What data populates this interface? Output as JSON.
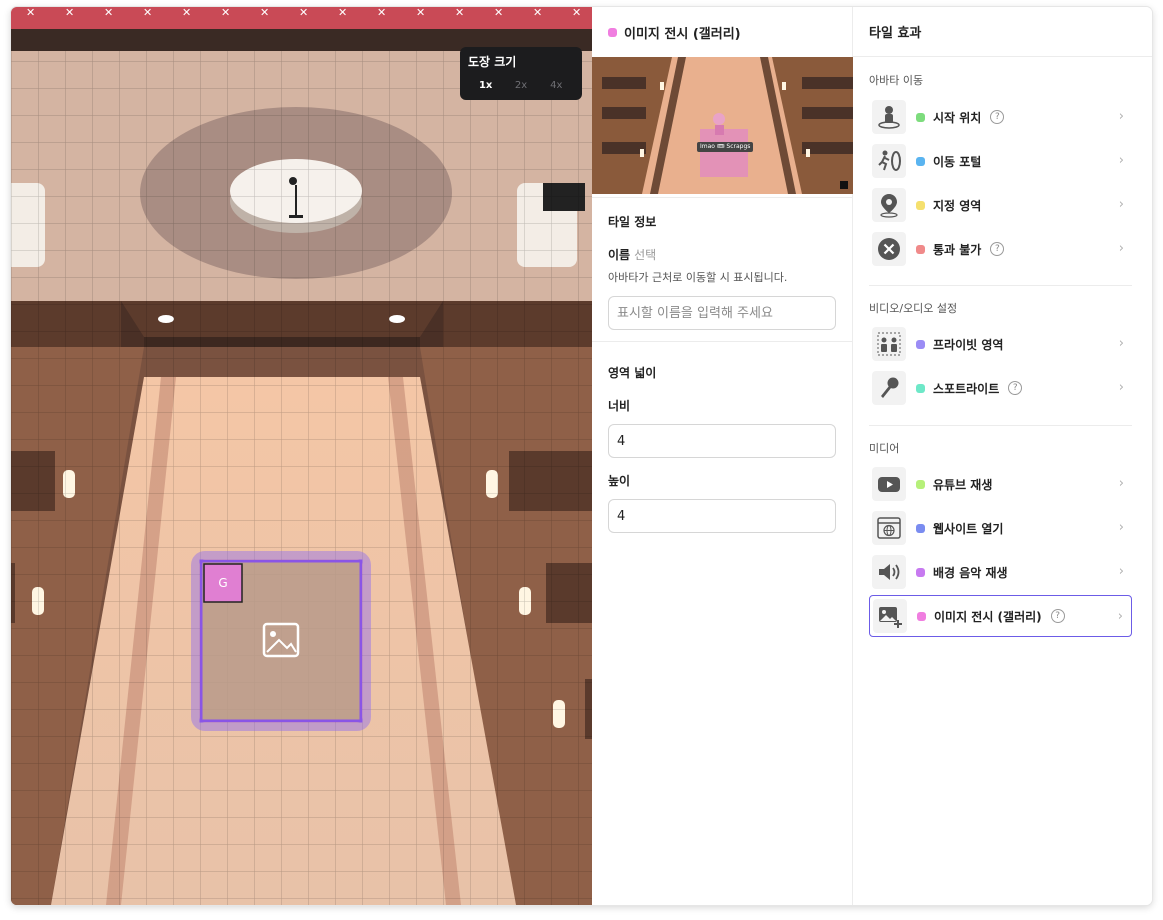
{
  "canvas": {
    "zoom": {
      "title": "도장 크기",
      "options": [
        "1x",
        "2x",
        "4x"
      ],
      "selected": "1x"
    },
    "tile_marker": "G"
  },
  "tile_panel": {
    "title": "이미지 전시 (갤러리)",
    "color": "#f07ee0",
    "preview": {
      "nameplate": "Imao 🎟 Scrapgs"
    },
    "info": {
      "section_title": "타일 정보",
      "name_label": "이름",
      "name_optional": "선택",
      "name_hint": "아바타가 근처로 이동할 시 표시됩니다.",
      "name_placeholder": "표시할 이름을 입력해 주세요",
      "name_value": ""
    },
    "area": {
      "section_title": "영역 넓이",
      "width_label": "너비",
      "width_value": "4",
      "height_label": "높이",
      "height_value": "4"
    }
  },
  "effects_panel": {
    "title": "타일 효과",
    "groups": [
      {
        "title": "아바타 이동",
        "items": [
          {
            "label": "시작 위치",
            "color": "#7ddc7d",
            "icon": "avatar-spawn-icon",
            "help": true
          },
          {
            "label": "이동 포털",
            "color": "#5ab4f0",
            "icon": "portal-icon",
            "help": false
          },
          {
            "label": "지정 영역",
            "color": "#f5e06e",
            "icon": "location-pin-icon",
            "help": false
          },
          {
            "label": "통과 불가",
            "color": "#f08a8a",
            "icon": "blocked-icon",
            "help": true
          }
        ]
      },
      {
        "title": "비디오/오디오 설정",
        "items": [
          {
            "label": "프라이빗 영역",
            "color": "#9b8cf5",
            "icon": "private-area-icon",
            "help": false
          },
          {
            "label": "스포트라이트",
            "color": "#6ee8c8",
            "icon": "microphone-icon",
            "help": true
          }
        ]
      },
      {
        "title": "미디어",
        "items": [
          {
            "label": "유튜브 재생",
            "color": "#b6f07a",
            "icon": "youtube-play-icon",
            "help": false
          },
          {
            "label": "웹사이트 열기",
            "color": "#7a8cf0",
            "icon": "website-icon",
            "help": false
          },
          {
            "label": "배경 음악 재생",
            "color": "#c77af0",
            "icon": "speaker-icon",
            "help": false
          },
          {
            "label": "이미지 전시 (갤러리)",
            "color": "#f07ee0",
            "icon": "image-add-icon",
            "help": true,
            "selected": true
          }
        ]
      }
    ]
  }
}
